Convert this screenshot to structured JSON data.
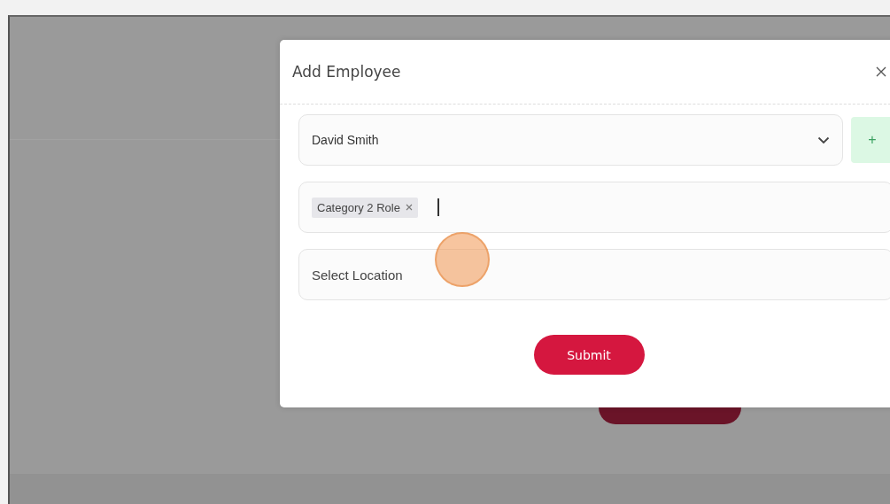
{
  "dialog": {
    "title": "Add Employee",
    "employee_select": {
      "value": "David Smith"
    },
    "add_button": {
      "label": "+"
    },
    "roles": {
      "tags": [
        {
          "label": "Category 2 Role"
        }
      ]
    },
    "location": {
      "placeholder": "Select Location"
    },
    "submit": {
      "label": "Submit"
    }
  }
}
